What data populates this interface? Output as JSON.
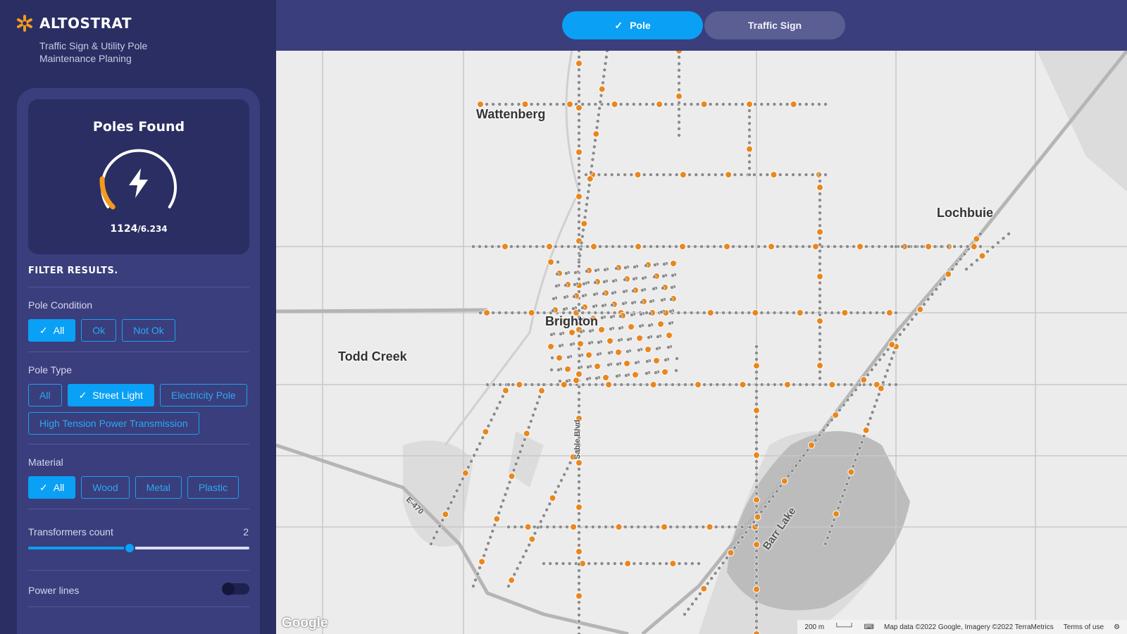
{
  "brand": {
    "name": "ALTOSTRAT",
    "tagline": "Traffic Sign & Utility Pole Maintenance Planing",
    "accent": "#f39a1e"
  },
  "topbar": {
    "tabs": [
      {
        "label": "Pole",
        "active": true,
        "icon": "check-icon"
      },
      {
        "label": "Traffic Sign",
        "active": false
      }
    ]
  },
  "summary": {
    "title": "Poles Found",
    "icon": "lightning-bolt-icon",
    "found": "1124",
    "total": "/6.234",
    "progress": 0.18
  },
  "filters": {
    "title": "FILTER RESULTS.",
    "pole_condition": {
      "label": "Pole Condition",
      "options": [
        "All",
        "Ok",
        "Not Ok"
      ],
      "selected": "All"
    },
    "pole_type": {
      "label": "Pole Type",
      "options": [
        "All",
        "Street Light",
        "Electricity Pole",
        "High Tension Power Transmission"
      ],
      "selected": "Street Light"
    },
    "material": {
      "label": "Material",
      "options": [
        "All",
        "Wood",
        "Metal",
        "Plastic"
      ],
      "selected": "All"
    },
    "transformers": {
      "label": "Transformers count",
      "value": "2",
      "fraction": 0.46
    },
    "power_lines": {
      "label": "Power lines",
      "on": false
    }
  },
  "map": {
    "places": [
      "Wattenberg",
      "Lochbuie",
      "Brighton",
      "Todd Creek"
    ],
    "lake": "Barr Lake",
    "roads": [
      "Sable Blvd",
      "E-470"
    ],
    "scale": "200 m",
    "attribution": "Map data ©2022 Google, Imagery ©2022 TerraMetrics",
    "terms": "Terms of use",
    "logo": "Google",
    "colors": {
      "pole_ok": "#8c8c8c",
      "pole_flagged": "#e8871e"
    }
  }
}
